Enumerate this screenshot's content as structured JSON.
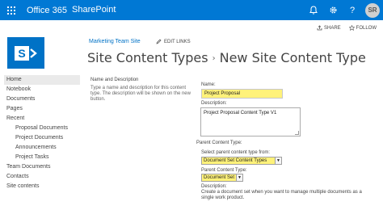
{
  "suitebar": {
    "brand": "Office 365",
    "app": "SharePoint",
    "bell_glyph": "🔔",
    "gear_glyph": "⚙",
    "help_glyph": "?",
    "avatar_initials": "SR"
  },
  "header": {
    "site_link": "Marketing Team Site",
    "edit_links": "EDIT LINKS",
    "title_parent": "Site Content Types",
    "title_separator": "›",
    "title_current": "New Site Content Type",
    "share": "SHARE",
    "follow": "FOLLOW"
  },
  "leftnav": {
    "items": [
      {
        "label": "Home",
        "selected": true,
        "sub": false
      },
      {
        "label": "Notebook",
        "selected": false,
        "sub": false
      },
      {
        "label": "Documents",
        "selected": false,
        "sub": false
      },
      {
        "label": "Pages",
        "selected": false,
        "sub": false
      },
      {
        "label": "Recent",
        "selected": false,
        "sub": false
      },
      {
        "label": "Proposal Documents",
        "selected": false,
        "sub": true
      },
      {
        "label": "Project Documents",
        "selected": false,
        "sub": true
      },
      {
        "label": "Announcements",
        "selected": false,
        "sub": true
      },
      {
        "label": "Project Tasks",
        "selected": false,
        "sub": true
      },
      {
        "label": "Team Documents",
        "selected": false,
        "sub": false
      },
      {
        "label": "Contacts",
        "selected": false,
        "sub": false
      },
      {
        "label": "Site contents",
        "selected": false,
        "sub": false
      }
    ]
  },
  "form": {
    "section_title": "Name and Description",
    "section_desc": "Type a name and description for this content type. The description will be shown on the new button.",
    "name_label": "Name:",
    "name_value": "Project Proposal",
    "description_label": "Description:",
    "description_value": "Project Proposal Content Type V1",
    "parent_label": "Parent Content Type:",
    "parent_from_label": "Select parent content type from:",
    "parent_from_value": "Document Set Content Types",
    "parent_ct_label": "Parent Content Type:",
    "parent_ct_value": "Document Set",
    "parent_desc_label": "Description:",
    "parent_desc_value": "Create a document set when you want to manage multiple documents as a single work product."
  },
  "colors": {
    "suitebar": "#0078d4",
    "logo_tile": "#0072c6",
    "highlight": "#fff27a"
  }
}
